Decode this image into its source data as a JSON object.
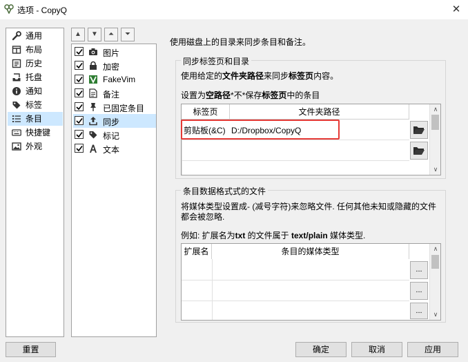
{
  "window": {
    "title": "选项 - CopyQ"
  },
  "categories": [
    {
      "label": "通用",
      "icon": "wrench-icon"
    },
    {
      "label": "布局",
      "icon": "layout-icon"
    },
    {
      "label": "历史",
      "icon": "history-icon"
    },
    {
      "label": "托盘",
      "icon": "tray-icon"
    },
    {
      "label": "通知",
      "icon": "info-icon"
    },
    {
      "label": "标签",
      "icon": "tag-icon"
    },
    {
      "label": "条目",
      "icon": "list-icon",
      "selected": true
    },
    {
      "label": "快捷键",
      "icon": "keyboard-icon"
    },
    {
      "label": "外观",
      "icon": "image-icon"
    }
  ],
  "plugins": [
    {
      "label": "图片",
      "icon": "camera-icon",
      "checked": true
    },
    {
      "label": "加密",
      "icon": "lock-icon",
      "checked": true
    },
    {
      "label": "FakeVim",
      "icon": "fakevim-icon",
      "checked": true
    },
    {
      "label": "备注",
      "icon": "note-icon",
      "checked": true
    },
    {
      "label": "已固定条目",
      "icon": "pin-icon",
      "checked": true
    },
    {
      "label": "同步",
      "icon": "sync-icon",
      "checked": true,
      "selected": true
    },
    {
      "label": "标记",
      "icon": "tag-icon",
      "checked": true
    },
    {
      "label": "文本",
      "icon": "text-icon",
      "checked": true
    }
  ],
  "sync": {
    "description": "使用磁盘上的目录来同步条目和备注。",
    "group1_title": "同步标签页和目录",
    "line1": {
      "a": "使用给定的",
      "b": "文件夹路径",
      "c": "来同步",
      "d": "标签页",
      "e": "内容。"
    },
    "line2": {
      "a": "设置为",
      "b": "空路径",
      "c": "*不*保存",
      "d": "标签页",
      "e": "中的条目"
    },
    "tab_col": "标签页",
    "path_col": "文件夹路径",
    "rows": [
      {
        "tab": "剪贴板(&C)",
        "path": "D:/Dropbox/CopyQ"
      }
    ],
    "group2_title": "条目数据格式式的文件",
    "line3": "将媒体类型设置成- (减号字符)来忽略文件. 任何其他未知或隐藏的文件",
    "line4": "都会被忽略.",
    "line5": {
      "a": "例如: 扩展名为",
      "b": "txt",
      "c": " 的文件属于 ",
      "d": "text/plain",
      "e": " 媒体类型."
    },
    "ext_col": "扩展名",
    "mime_col": "条目的媒体类型",
    "more_btn": "..."
  },
  "buttons": {
    "reset": "重置",
    "ok": "确定",
    "cancel": "取消",
    "apply": "应用"
  },
  "accent": "#e53935"
}
